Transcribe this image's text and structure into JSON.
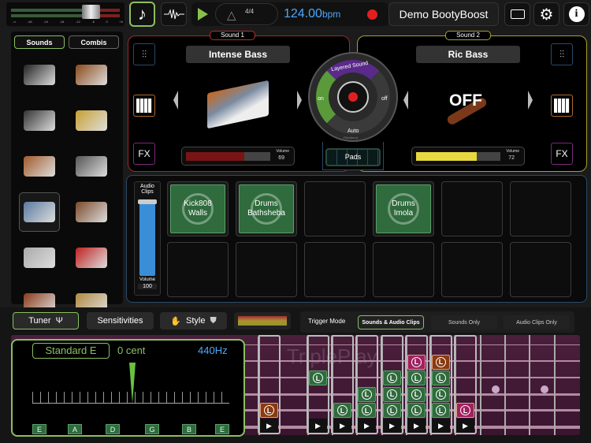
{
  "topbar": {
    "meter_ticks": [
      "-∞",
      "-48",
      "-24",
      "-18",
      "-12",
      "-6",
      "0",
      "+6"
    ],
    "time_signature": "4/4",
    "tempo": "124.00",
    "tempo_unit": "bpm",
    "song_name": "Demo BootyBoost"
  },
  "library": {
    "tabs": [
      "Sounds",
      "Combis"
    ],
    "active_tab": "Sounds",
    "instruments": [
      "grand-piano",
      "strings",
      "upright-piano",
      "brass",
      "organ",
      "woodwinds",
      "synth",
      "marimba",
      "keyboard",
      "electric-guitar",
      "bass-guitar",
      "drums"
    ],
    "selected": "synth"
  },
  "sound1": {
    "label": "Sound 1",
    "name": "Intense Bass",
    "volume_label": "Volume",
    "volume": 69,
    "fx": "FX",
    "color": "#7a1414"
  },
  "sound2": {
    "label": "Sound 2",
    "name": "Ric Bass",
    "status": "OFF",
    "volume_label": "Volume",
    "volume": 72,
    "fx": "FX",
    "color": "#e8d840"
  },
  "layer": {
    "title": "Layered Sound",
    "on": "on",
    "off": "off",
    "auto": "Auto",
    "pitchbend": "Pitchbend",
    "pads": "Pads"
  },
  "clips": {
    "label": "Audio Clips",
    "volume_label": "Volume",
    "volume": 100,
    "pads": [
      [
        "Kick808",
        "Walls"
      ],
      [
        "Drums",
        "Bathsheba"
      ],
      null,
      [
        "Drums",
        "Imola"
      ],
      null,
      null,
      null,
      null,
      null,
      null,
      null,
      null
    ]
  },
  "bottom": {
    "tuner": "Tuner",
    "sensitivities": "Sensitivities",
    "style": "Style",
    "trigger_mode": "Trigger Mode",
    "modes": [
      "Sounds & Audio Clips",
      "Sounds Only",
      "Audio Clips Only"
    ],
    "active_mode": "Sounds & Audio Clips"
  },
  "tuner_popup": {
    "tuning": "Standard E",
    "cents": "0 cent",
    "reference": "440Hz",
    "strings": [
      "E",
      "A",
      "D",
      "G",
      "B",
      "E"
    ]
  },
  "fretboard": {
    "watermark": "TriplePlay Connect",
    "clip_columns": [
      [
        "",
        "",
        "",
        "",
        "o"
      ],
      [
        "",
        "",
        "g",
        "",
        ""
      ],
      [
        "",
        "",
        "",
        "",
        "g"
      ],
      [
        "",
        "",
        "",
        "g",
        "g"
      ],
      [
        "",
        "",
        "g",
        "g",
        "g"
      ],
      [
        "",
        "p",
        "g",
        "g",
        "g"
      ],
      [
        "",
        "o",
        "g",
        "g",
        "g"
      ],
      [
        "",
        "",
        "",
        "",
        "p"
      ]
    ],
    "clip_letter": "L"
  }
}
